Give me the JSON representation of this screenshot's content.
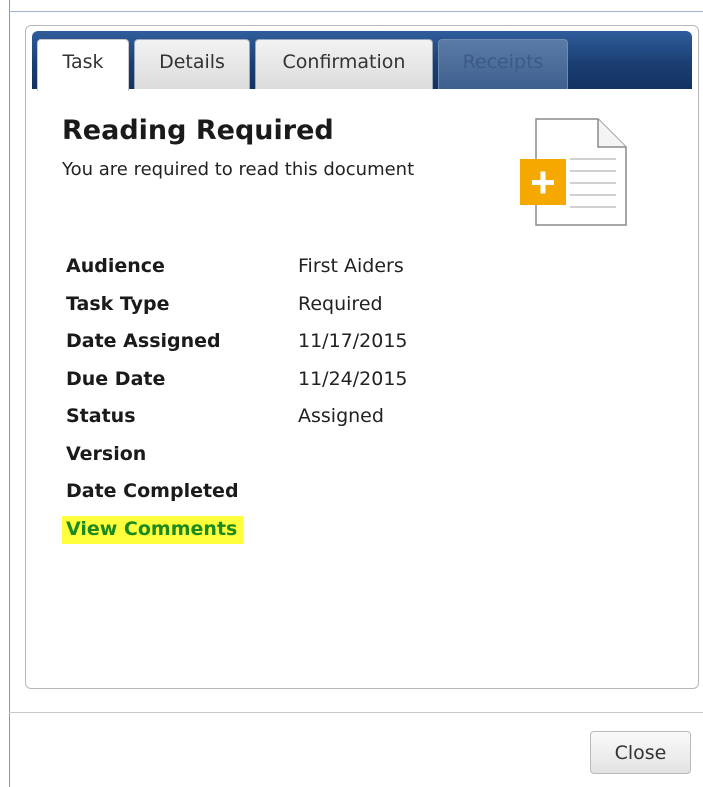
{
  "tabs": {
    "task": "Task",
    "details": "Details",
    "confirmation": "Confirmation",
    "receipts": "Receipts"
  },
  "task": {
    "title": "Reading Required",
    "subtitle": "You are required to read this document",
    "icon": "document-add-icon"
  },
  "fields": {
    "audience": {
      "label": "Audience",
      "value": "First Aiders"
    },
    "task_type": {
      "label": "Task Type",
      "value": "Required"
    },
    "date_assigned": {
      "label": "Date Assigned",
      "value": "11/17/2015"
    },
    "due_date": {
      "label": "Due Date",
      "value": "11/24/2015"
    },
    "status": {
      "label": "Status",
      "value": "Assigned"
    },
    "version": {
      "label": "Version",
      "value": ""
    },
    "date_completed": {
      "label": "Date Completed",
      "value": ""
    }
  },
  "links": {
    "view_comments": "View Comments"
  },
  "footer": {
    "close_label": "Close"
  },
  "colors": {
    "tabbar": "#1b3f73",
    "link_text": "#1d8a1d",
    "highlight": "#ffff3b",
    "icon_accent": "#f5a800"
  }
}
